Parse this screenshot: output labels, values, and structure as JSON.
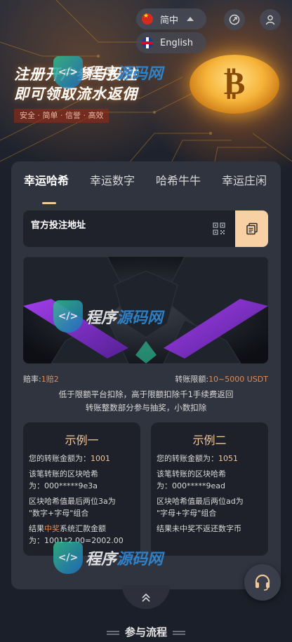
{
  "header": {
    "language_current": "简中",
    "language_alt": "English",
    "export_icon": "external-link-icon",
    "user_icon": "user-icon"
  },
  "hero": {
    "title_line1": "注册开户参与投注",
    "title_line2": "即可领取流水返佣",
    "tagline": "安全 · 简单 · 信誉 · 高效"
  },
  "tabs": [
    "幸运哈希",
    "幸运数字",
    "哈希牛牛",
    "幸运庄闲"
  ],
  "address": {
    "label": "官方投注地址",
    "qr_icon": "qr-code-icon",
    "copy_icon": "copy-icon"
  },
  "odds": {
    "odds_label": "赔率:",
    "odds_value": "1赔2",
    "limit_label": "转账限额:",
    "limit_value": "10~5000 USDT"
  },
  "notes": {
    "line1": "低于限额平台扣除，高于限额扣除千1手续费返回",
    "line2": "转账整数部分参与抽奖，小数扣除"
  },
  "examples": [
    {
      "title": "示例一",
      "amount_label": "您的转账金额为：",
      "amount": "1001",
      "hash_label1": "该笔转账的区块哈希",
      "hash_label2": "为：",
      "hash": "000*****9e3a",
      "rule1": "区块哈希值最后两位3a为",
      "rule2": "\"数字+字母\"组合",
      "result_prefix": "结果",
      "result_highlight": "中奖",
      "result_suffix": "系统汇款金额",
      "result_line2": "为：1001*2.00=2002.00"
    },
    {
      "title": "示例二",
      "amount_label": "您的转账金额为：",
      "amount": "1051",
      "hash_label1": "该笔转账的区块哈希",
      "hash_label2": "为：",
      "hash": "000*****9ead",
      "rule1": "区块哈希值最后两位ad为",
      "rule2": "\"字母+字母\"组合",
      "result_full": "结果未中奖不返还数字币"
    }
  ],
  "watermark": {
    "part1": "程序",
    "part2": "源码网"
  },
  "footer": {
    "section_title": "参与流程"
  },
  "colors": {
    "accent": "#f0c89a",
    "orange": "#e08a55",
    "card": "#30343f",
    "background": "#1b1f29"
  }
}
